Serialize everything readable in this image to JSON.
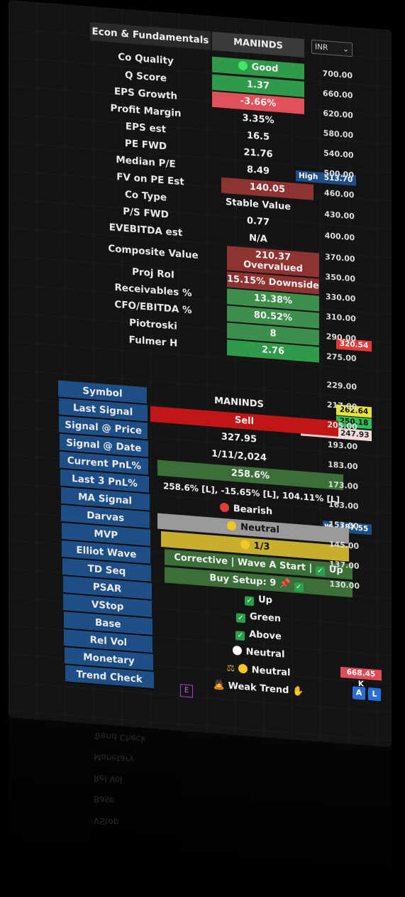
{
  "header": {
    "title": "Econ & Fundamentals",
    "symbol": "MANINDS",
    "currency": "INR"
  },
  "fundamentals": [
    {
      "label": "Co Quality",
      "value": "Good"
    },
    {
      "label": "Q Score",
      "value": "1.37"
    },
    {
      "label": "EPS Growth",
      "value": "-3.66%"
    },
    {
      "label": "Profit Margin",
      "value": "3.35%"
    },
    {
      "label": "EPS est",
      "value": "16.5"
    },
    {
      "label": "PE FWD",
      "value": "21.76"
    },
    {
      "label": "Median P/E",
      "value": "8.49"
    },
    {
      "label": "FV on PE Est",
      "value": "140.05"
    },
    {
      "label": "Co Type",
      "value": "Stable Value"
    },
    {
      "label": "P/S FWD",
      "value": "0.77"
    },
    {
      "label": "EVEBITDA est",
      "value": "N/A"
    },
    {
      "label": "Composite Value",
      "value": "210.37",
      "value2": "Overvalued"
    },
    {
      "label": "Proj RoI",
      "value": "15.15% Downside"
    },
    {
      "label": "Receivables %",
      "value": "13.38%"
    },
    {
      "label": "CFO/EBITDA %",
      "value": "80.52%"
    },
    {
      "label": "Piotroski",
      "value": "8"
    },
    {
      "label": "Fulmer H",
      "value": "2.76"
    }
  ],
  "signals": [
    {
      "label": "Symbol",
      "value": "MANINDS"
    },
    {
      "label": "Last Signal",
      "value": "Sell"
    },
    {
      "label": "Signal @ Price",
      "value": "327.95"
    },
    {
      "label": "Signal @ Date",
      "value": "1/11/2,024"
    },
    {
      "label": "Current PnL%",
      "value": "258.6%"
    },
    {
      "label": "Last 3 PnL%",
      "value": "258.6% [L], -15.65% [L], 104.11% [L]"
    },
    {
      "label": "MA Signal",
      "value": "Bearish"
    },
    {
      "label": "Darvas",
      "value": "Neutral"
    },
    {
      "label": "MVP",
      "value": "1/3"
    },
    {
      "label": "Elliot Wave",
      "value": "Corrective | Wave A Start |",
      "value2": "Up"
    },
    {
      "label": "TD Seq",
      "value": "Buy Setup: 9"
    },
    {
      "label": "PSAR",
      "value": "Up"
    },
    {
      "label": "VStop",
      "value": "Green"
    },
    {
      "label": "Base",
      "value": "Above"
    },
    {
      "label": "Rel Vol",
      "value": "Neutral"
    },
    {
      "label": "Monetary",
      "value": "Neutral"
    },
    {
      "label": "Trend Check",
      "value": "Weak Trend"
    }
  ],
  "axis": {
    "ticks": [
      "700.00",
      "660.00",
      "620.00",
      "580.00",
      "540.00",
      "500.00",
      "460.00",
      "430.00",
      "400.00",
      "370.00",
      "350.00",
      "330.00",
      "310.00",
      "290.00",
      "275.00",
      "229.00",
      "217.00",
      "205.00",
      "193.00",
      "183.00",
      "173.00",
      "163.00",
      "153.00",
      "145.00",
      "137.00",
      "130.00"
    ],
    "tags": {
      "high_label": "High",
      "high_value": "513.70",
      "red_price": "320.54",
      "yellow_price": "262.64",
      "green_price": "250.18",
      "symbol_tag": "MANINDS",
      "symbol_price": "247.93",
      "blue_price": "187.55",
      "blue_prefix": "w",
      "volume": "668.45 K",
      "btn_a": "A",
      "btn_l": "L",
      "btn_e": "E"
    }
  },
  "colors": {
    "green": "#2e9a4a",
    "red": "#e2505a",
    "dark_red": "#8e3232",
    "blue_label": "#1e4e86",
    "sell_red": "#c01616",
    "neutral_gray": "#9a9a9a",
    "mvp_yellow": "#c7ae2c"
  }
}
